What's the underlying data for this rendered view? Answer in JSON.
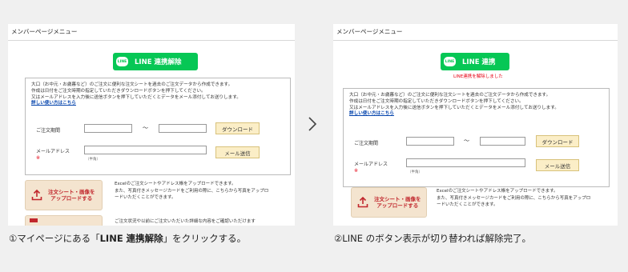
{
  "left": {
    "header": "メンバーページメニュー",
    "line_logo": "LINE",
    "line_button": "LINE 連携解除",
    "intro": [
      "大口（お中元・お歳暮など）のご注文に便利な注文シートを過去のご注文データから作成できます。",
      "作成は日付をご注文時期の指定していただきダウンロードボタンを押下してください。",
      "又はメールアドレスを入力後に送信ボタンを押下していただくとデータをメール添付してお送りします。"
    ],
    "usage_link": "詳しい使い方はこちら",
    "period_label": "ご注文期間",
    "tilde": "～",
    "download_button": "ダウンロード",
    "email_label": "メールアドレス",
    "required_mark": "※",
    "halfwidth_note": "（半角）",
    "send_button": "メール送信",
    "upload_button": "注文シート・画像を\nアップロードする",
    "upload_desc": [
      "Excelのご注文シートやアドレス帳をアップロードできます。",
      "また、写真付きメッセージカードをご利用の際に、こちらから写真をアップロ",
      "ードいただくことができます。"
    ],
    "more_text": "ご注文状況や以前にご注文いただいた詳細な内容をご確認いただけます"
  },
  "right": {
    "header": "メンバーページメニュー",
    "line_logo": "LINE",
    "line_button": "LINE 連携",
    "notice": "LINE連携を解除しました",
    "intro": [
      "大口（お中元・お歳暮など）のご注文に便利な注文シートを過去のご注文データから作成できます。",
      "作成は日付をご注文時期の指定していただきダウンロードボタンを押下してください。",
      "又はメールアドレスを入力後に送信ボタンを押下していただくとデータをメール添付してお送りします。"
    ],
    "usage_link": "詳しい使い方はこちら",
    "period_label": "ご注文期間",
    "tilde": "～",
    "download_button": "ダウンロード",
    "email_label": "メールアドレス",
    "required_mark": "※",
    "halfwidth_note": "（半角）",
    "send_button": "メール送信",
    "upload_button": "注文シート・画像を\nアップロードする",
    "upload_desc": [
      "Excelのご注文シートやアドレス帳をアップロードできます。",
      "また、写真付きメッセージカードをご利用の際に、こちらから写真をアップロ",
      "ードいただくことができます。"
    ]
  },
  "captions": {
    "left_pre": "①マイページにある「",
    "left_bold": "LINE 連携解除",
    "left_post": "」をクリックする。",
    "right": "②LINE のボタン表示が切り替われば解除完了。"
  },
  "colors": {
    "line_green": "#06c755",
    "notice_red": "#e60012",
    "upload_bg": "#f4e4cf",
    "button_yellow": "#fbeec7"
  },
  "icons": {
    "arrow": "chevron-right-icon",
    "upload": "upload-icon",
    "line": "line-logo-icon"
  }
}
